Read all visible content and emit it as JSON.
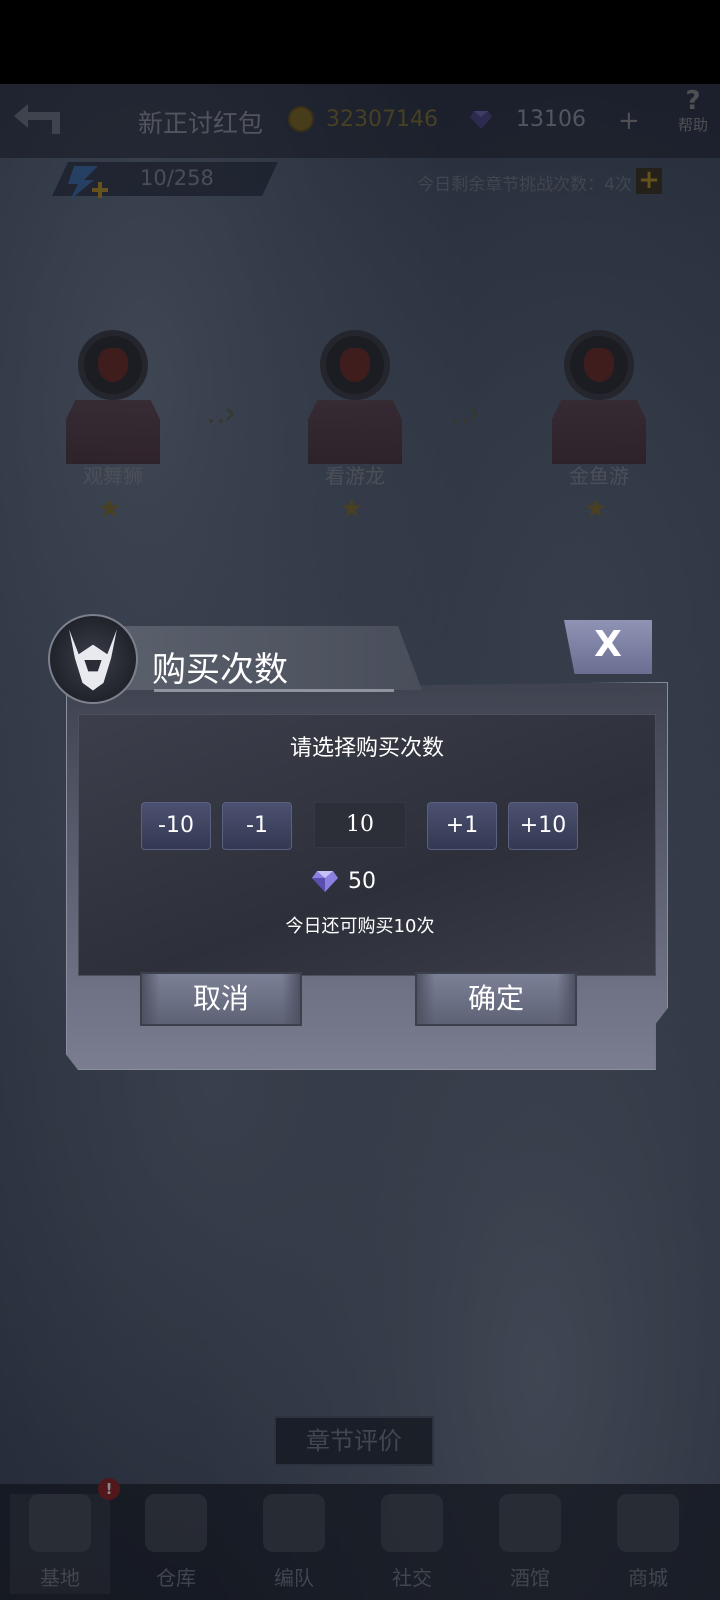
{
  "header": {
    "title": "新正讨红包",
    "coins": "32307146",
    "gems": "13106",
    "plus_label": "+",
    "help_label": "帮助",
    "help_glyph": "?"
  },
  "energy": {
    "value": "10/258",
    "remaining_text": "今日剩余章节挑战次数：4次",
    "remaining_plus": "+"
  },
  "stages": [
    {
      "name": "观舞狮",
      "star": "★"
    },
    {
      "name": "看游龙",
      "star": "★"
    },
    {
      "name": "金鱼游",
      "star": "★"
    }
  ],
  "arrow_glyph": "‥›",
  "dialog": {
    "title": "购买次数",
    "close_label": "X",
    "prompt": "请选择购买次数",
    "minus10": "-10",
    "minus1": "-1",
    "quantity": "10",
    "plus1": "+1",
    "plus10": "+10",
    "cost": "50",
    "remaining_today": "今日还可购买10次",
    "cancel_label": "取消",
    "confirm_label": "确定"
  },
  "chapter_review": "章节评价",
  "nav": {
    "alert": "!",
    "items": [
      {
        "label": "基地",
        "icon": "base-icon"
      },
      {
        "label": "仓库",
        "icon": "warehouse-icon"
      },
      {
        "label": "编队",
        "icon": "squad-icon"
      },
      {
        "label": "社交",
        "icon": "handshake-icon"
      },
      {
        "label": "酒馆",
        "icon": "tavern-icon"
      },
      {
        "label": "商城",
        "icon": "shop-icon"
      }
    ]
  },
  "colors": {
    "gem": "#6c5cc8",
    "coin": "#7a6420",
    "accent_button": "#4b5170"
  }
}
